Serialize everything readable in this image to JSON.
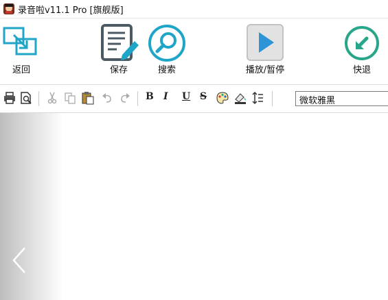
{
  "window": {
    "title": "录音啦v11.1 Pro [旗舰版]"
  },
  "toolbar": {
    "back_label": "返回",
    "save_label": "保存",
    "search_label": "搜索",
    "play_pause_label": "播放/暂停",
    "fast_back_label": "快退"
  },
  "format_toolbar": {
    "bold": "B",
    "italic": "I",
    "underline": "U",
    "strikethrough": "S",
    "font_value": "微软雅黑"
  },
  "colors": {
    "accent_teal": "#1fa5c7",
    "play_blue": "#2f93d8",
    "fast_back_green": "#27a68a",
    "save_gray": "#4b5963"
  },
  "icons": [
    "app-icon",
    "back-icon",
    "save-icon",
    "search-icon",
    "play-icon",
    "rewind-icon",
    "print-icon",
    "print-preview-icon",
    "cut-icon",
    "copy-icon",
    "paste-icon",
    "undo-icon",
    "redo-icon",
    "color-palette-icon",
    "highlight-icon",
    "line-spacing-icon",
    "chevron-left-icon"
  ]
}
